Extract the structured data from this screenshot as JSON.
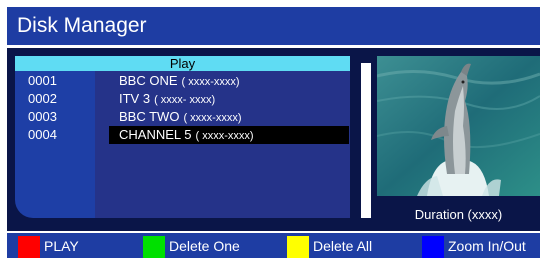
{
  "window": {
    "title": "Disk Manager"
  },
  "list": {
    "header": "Play",
    "rows": [
      {
        "num": "0001",
        "name": "BBC ONE",
        "code": "( xxxx-xxxx)"
      },
      {
        "num": "0002",
        "name": "ITV 3",
        "code": "( xxxx- xxxx)"
      },
      {
        "num": "0003",
        "name": "BBC TWO",
        "code": "( xxxx-xxxx)"
      },
      {
        "num": "0004",
        "name": "CHANNEL 5",
        "code": "( xxxx-xxxx)"
      }
    ],
    "selected_index": 3
  },
  "preview": {
    "duration": "Duration  (xxxx)"
  },
  "footer": {
    "buttons": [
      {
        "label": "PLAY",
        "color": "#ff0000"
      },
      {
        "label": "Delete One",
        "color": "#00e000"
      },
      {
        "label": "Delete All",
        "color": "#ffff00"
      },
      {
        "label": "Zoom In/Out",
        "color": "#0000ff"
      }
    ]
  }
}
